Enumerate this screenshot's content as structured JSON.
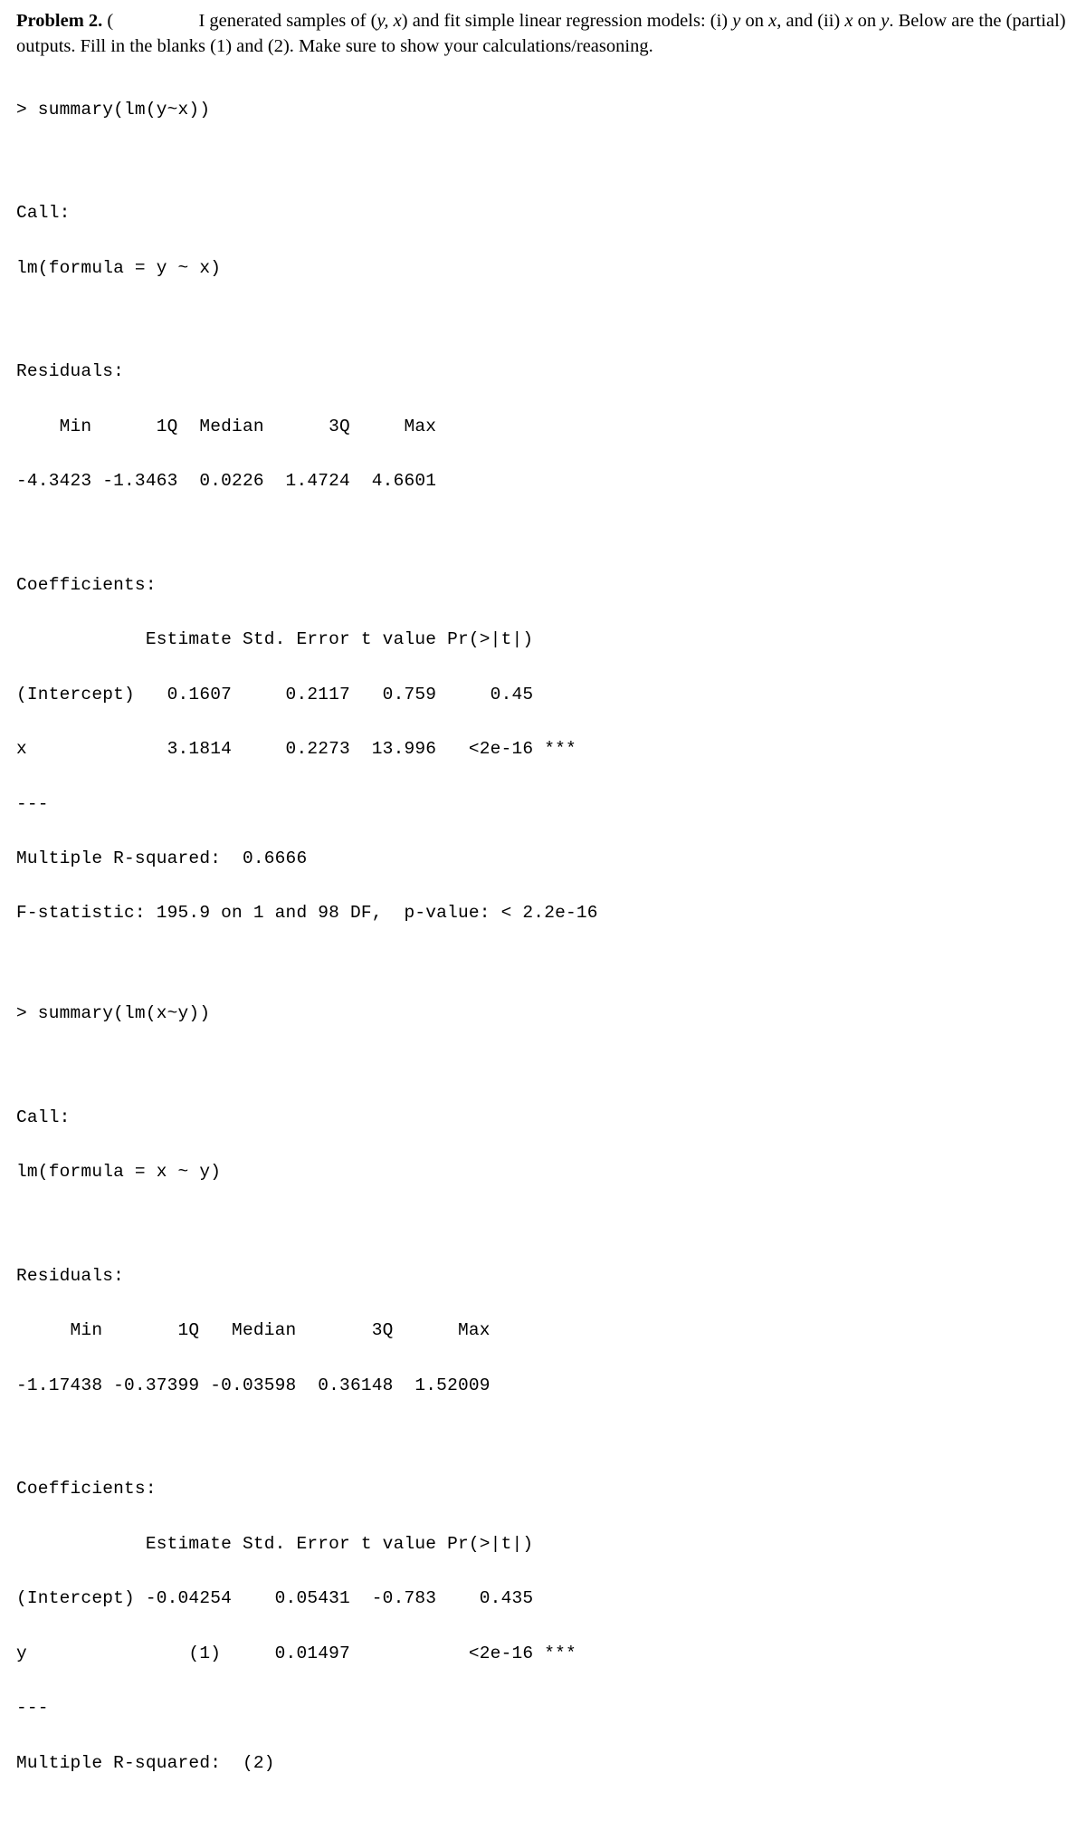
{
  "header": {
    "problem_label": "Problem 2.",
    "intro_1": "I generated samples of (",
    "intro_2": ") and fit simple linear regression models:  (i) ",
    "intro_3": " on ",
    "intro_4": ", and (ii) ",
    "intro_5": " on ",
    "intro_6": ".  Below are the (partial) outputs.  Fill in the blanks (1) and (2).  Make sure to show your calculations/reasoning.",
    "y": "y",
    "x": "x",
    "yx": "y, x",
    "lparen": " ("
  },
  "m1": {
    "summary_cmd": "> summary(lm(y~x))",
    "call_label": "Call:",
    "call_line": "lm(formula = y ~ x)",
    "resid_label": "Residuals:",
    "resid_head": "    Min      1Q  Median      3Q     Max ",
    "resid_vals": "-4.3423 -1.3463  0.0226  1.4724  4.6601 ",
    "coef_label": "Coefficients:",
    "coef_head": "            Estimate Std. Error t value Pr(>|t|)    ",
    "coef_row1": "(Intercept)   0.1607     0.2117   0.759     0.45    ",
    "coef_row2": "x             3.1814     0.2273  13.996   <2e-16 ***",
    "dash": "---",
    "r2": "Multiple R-squared:  0.6666",
    "fstat": "F-statistic: 195.9 on 1 and 98 DF,  p-value: < 2.2e-16"
  },
  "m2": {
    "summary_cmd": "> summary(lm(x~y))",
    "call_label": "Call:",
    "call_line": "lm(formula = x ~ y)",
    "resid_label": "Residuals:",
    "resid_head": "     Min       1Q   Median       3Q      Max ",
    "resid_vals": "-1.17438 -0.37399 -0.03598  0.36148  1.52009 ",
    "coef_label": "Coefficients:",
    "coef_head": "            Estimate Std. Error t value Pr(>|t|)    ",
    "coef_row1": "(Intercept) -0.04254    0.05431  -0.783    0.435    ",
    "coef_row2": "y               (1)     0.01497           <2e-16 ***",
    "dash": "---",
    "r2": "Multiple R-squared:  (2)"
  }
}
